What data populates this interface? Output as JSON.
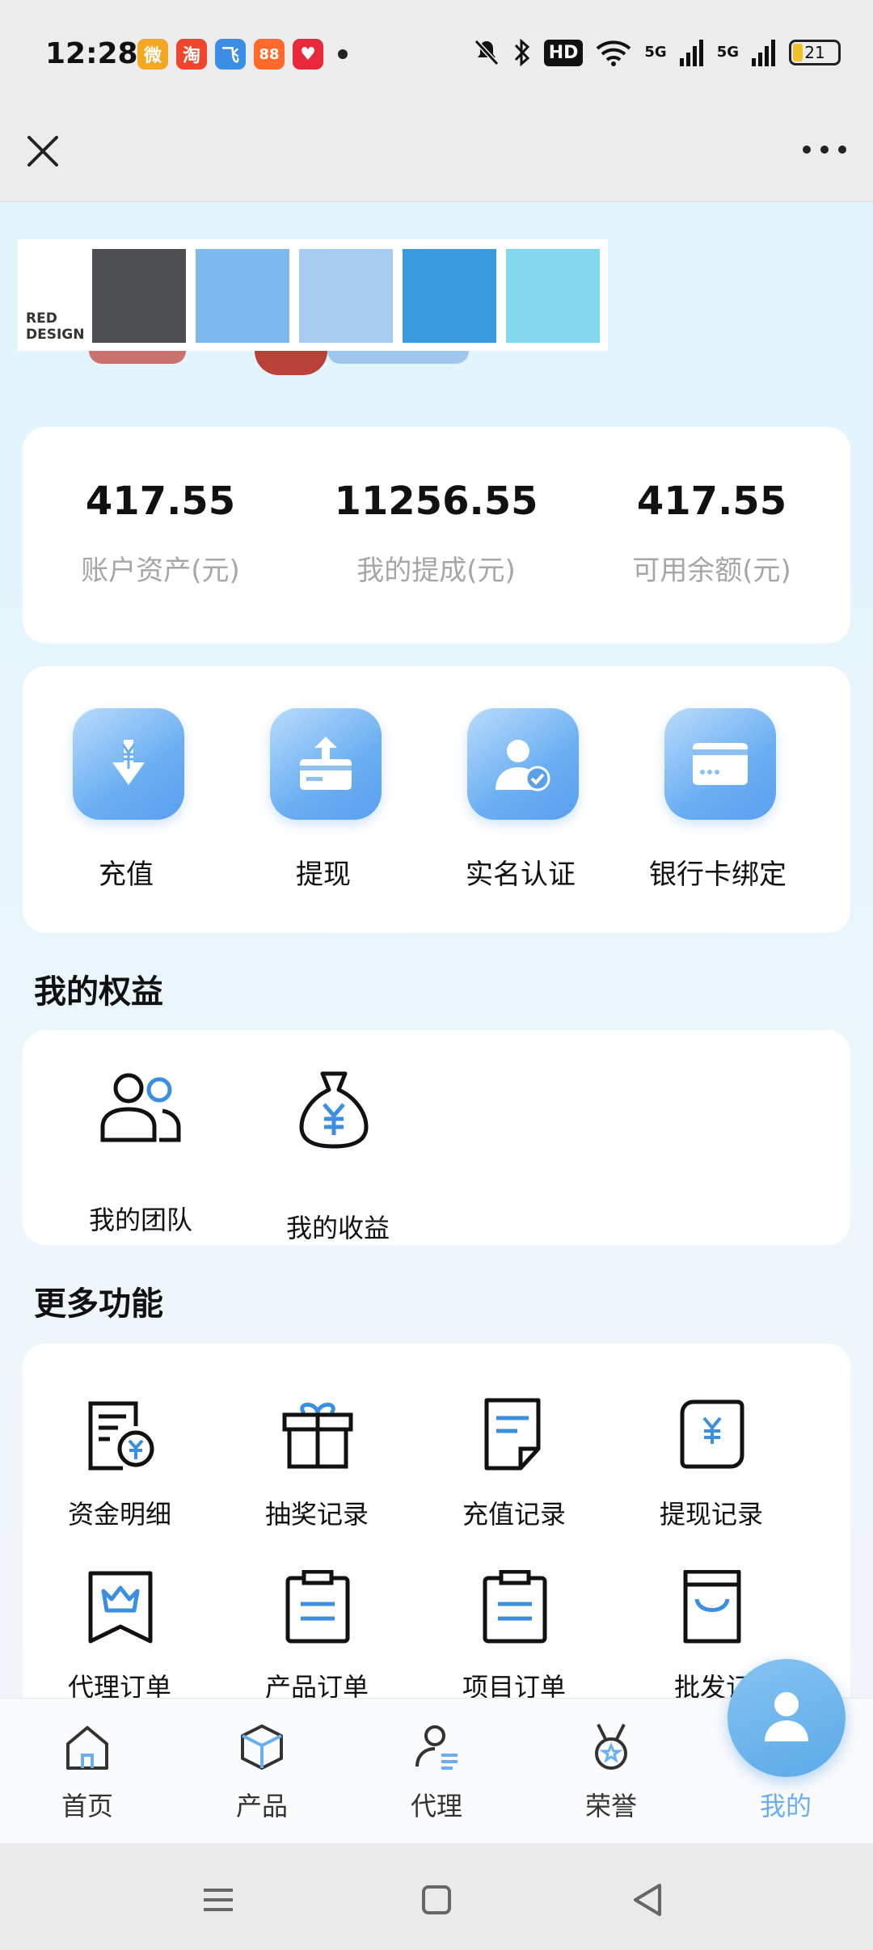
{
  "status_bar": {
    "time": "12:28",
    "notification_apps": [
      {
        "name": "weibo",
        "glyph": "微",
        "color": "#f5a623"
      },
      {
        "name": "taobao",
        "glyph": "淘",
        "color": "#f0452d"
      },
      {
        "name": "app-3",
        "glyph": "飞",
        "color": "#3a8ee6"
      },
      {
        "name": "app-4",
        "glyph": "88",
        "color": "#ff6a2a"
      },
      {
        "name": "app-5",
        "glyph": "♥",
        "color": "#e8283b"
      }
    ],
    "hd_label": "HD",
    "network_1": "5G",
    "network_2": "5G",
    "battery": "21"
  },
  "header": {
    "close_icon": "close-icon",
    "more_icon": "more-horizontal-icon"
  },
  "banner": {
    "palette_label": "RED\nDESIGN",
    "swatches": [
      "#4d4f53",
      "#7ebaf0",
      "#a8ccf2",
      "#3a9ae0",
      "#82d6ee"
    ]
  },
  "stats": [
    {
      "value": "417.55",
      "label": "账户资产(元)"
    },
    {
      "value": "11256.55",
      "label": "我的提成(元)"
    },
    {
      "value": "417.55",
      "label": "可用余额(元)"
    }
  ],
  "quick_actions": [
    {
      "label": "充值",
      "icon": "deposit-yen-icon"
    },
    {
      "label": "提现",
      "icon": "withdraw-card-icon"
    },
    {
      "label": "实名认证",
      "icon": "verified-user-icon"
    },
    {
      "label": "银行卡绑定",
      "icon": "bank-card-icon"
    }
  ],
  "benefits": {
    "title": "我的权益",
    "items": [
      {
        "label": "我的团队",
        "icon": "team-icon"
      },
      {
        "label": "我的收益",
        "icon": "money-bag-icon"
      }
    ]
  },
  "more_functions": {
    "title": "更多功能",
    "items": [
      {
        "label": "资金明细",
        "icon": "fund-detail-icon"
      },
      {
        "label": "抽奖记录",
        "icon": "gift-icon"
      },
      {
        "label": "充值记录",
        "icon": "recharge-record-icon"
      },
      {
        "label": "提现记录",
        "icon": "withdraw-record-icon"
      },
      {
        "label": "代理订单",
        "icon": "crown-bookmark-icon"
      },
      {
        "label": "产品订单",
        "icon": "clipboard-icon"
      },
      {
        "label": "项目订单",
        "icon": "clipboard-icon"
      },
      {
        "label": "批发订",
        "icon": "shopping-bag-icon"
      }
    ]
  },
  "bottom_nav": [
    {
      "label": "首页",
      "icon": "home-icon"
    },
    {
      "label": "产品",
      "icon": "box-icon"
    },
    {
      "label": "代理",
      "icon": "agent-user-icon"
    },
    {
      "label": "荣誉",
      "icon": "medal-icon"
    },
    {
      "label": "我的",
      "icon": "profile-icon",
      "active": true
    }
  ],
  "colors": {
    "accent_blue": "#6aaef0",
    "label_grey": "#a6a6a6",
    "icon_blue": "#3a8fe0"
  }
}
